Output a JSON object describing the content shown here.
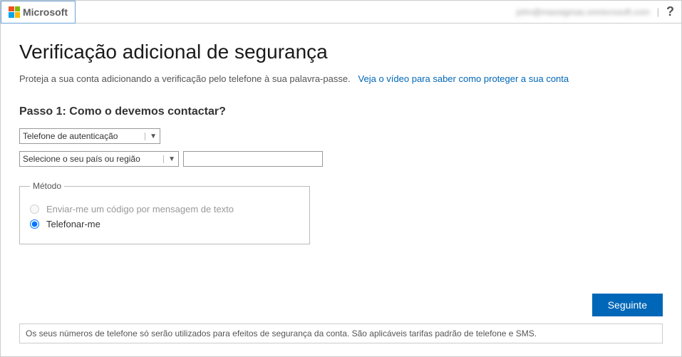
{
  "header": {
    "brand": "Microsoft",
    "user_email": "john@maxsigmas.onmicrosoft.com",
    "help": "?"
  },
  "page": {
    "title": "Verificação adicional de segurança",
    "subtitle_text": "Proteja a sua conta adicionando a verificação pelo telefone à sua palavra-passe.",
    "subtitle_link": "Veja o vídeo para saber como proteger a sua conta"
  },
  "step": {
    "heading": "Passo 1: Como o devemos contactar?",
    "contact_method_selected": "Telefone de autenticação",
    "country_selected": "Selecione o seu país ou região",
    "phone_value": ""
  },
  "method": {
    "legend": "Método",
    "option_sms": "Enviar-me um código por mensagem de texto",
    "option_call": "Telefonar-me"
  },
  "actions": {
    "next": "Seguinte"
  },
  "footer": {
    "note": "Os seus números de telefone só serão utilizados para efeitos de segurança da conta. São aplicáveis tarifas padrão de telefone e SMS."
  }
}
